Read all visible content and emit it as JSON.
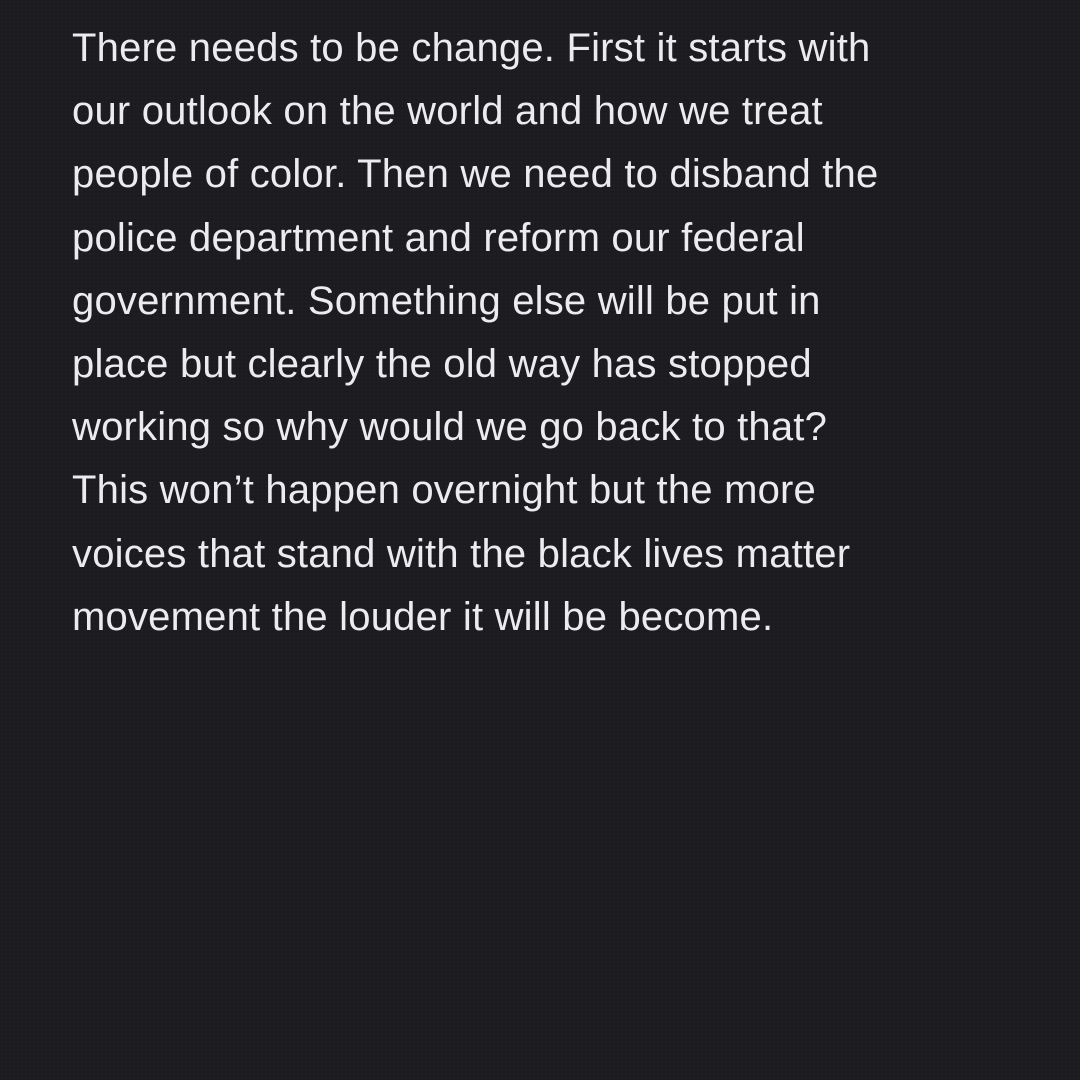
{
  "note": {
    "lines": [
      "There needs to be change. First it starts with",
      "our outlook on the world and how we treat",
      "people of color. Then we need to disband the",
      "police department and reform our federal",
      "government. Something else will be put in",
      "place but clearly the old way has stopped",
      "working so why would we go back to that?",
      "This won’t happen overnight but the more",
      "voices that stand with the black lives matter",
      "movement the louder it will be become."
    ]
  },
  "colors": {
    "background": "#1c1b20",
    "text": "#ececee"
  }
}
